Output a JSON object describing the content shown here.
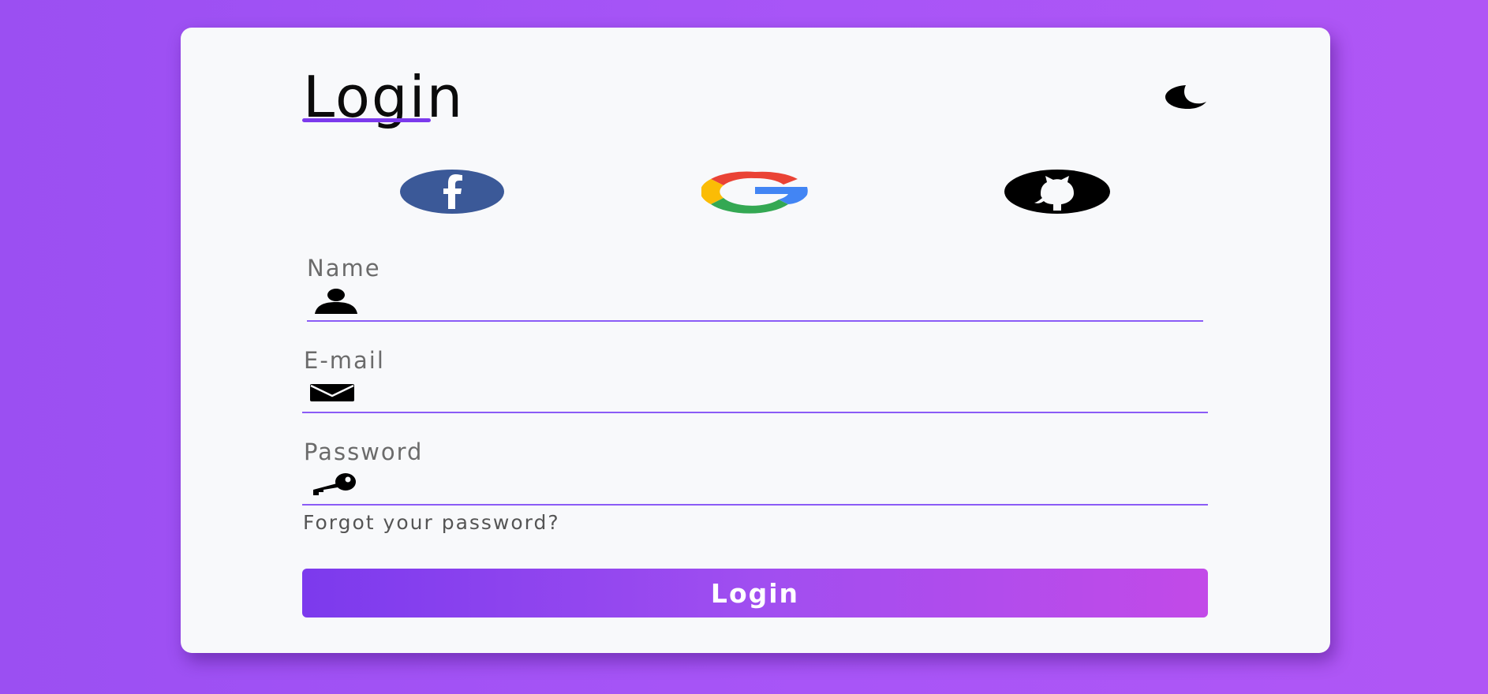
{
  "form": {
    "title": "Login",
    "theme_toggle_icon": "moon-icon",
    "social": [
      {
        "name": "facebook",
        "icon": "facebook-icon",
        "color": "#3b5998"
      },
      {
        "name": "google",
        "icon": "google-icon",
        "colors": [
          "#ea4335",
          "#fbbc05",
          "#34a853",
          "#4285f4"
        ]
      },
      {
        "name": "github",
        "icon": "github-icon",
        "color": "#000000"
      }
    ],
    "fields": {
      "name": {
        "label": "Name",
        "value": "",
        "placeholder": "",
        "icon": "user-icon"
      },
      "email": {
        "label": "E-mail",
        "value": "",
        "placeholder": "",
        "icon": "envelope-icon"
      },
      "password": {
        "label": "Password",
        "value": "",
        "placeholder": "",
        "icon": "key-icon"
      }
    },
    "forgot_link": "Forgot your password?",
    "submit_label": "Login"
  },
  "colors": {
    "accent": "#7c3aed",
    "background": "#a855f7",
    "card": "#f8f9fb"
  }
}
